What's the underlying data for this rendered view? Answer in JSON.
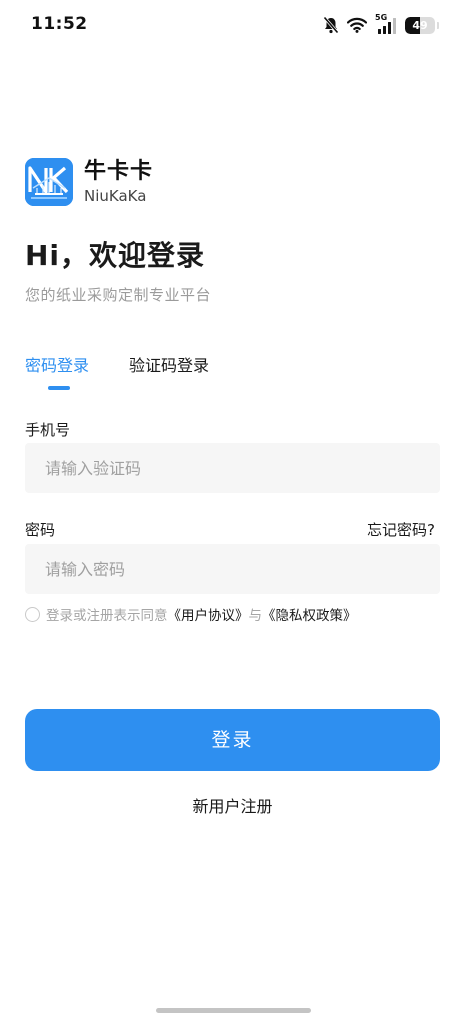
{
  "status_bar": {
    "time": "11:52",
    "network": "5G",
    "battery_level": "49",
    "battery_fraction": 0.49,
    "icons": [
      "silent-bell-icon",
      "wifi-icon",
      "signal-5g-icon",
      "battery-icon"
    ]
  },
  "brand": {
    "name": "牛卡卡",
    "subtitle": "NiuKaKa",
    "logo_icon": "niukaka-logo-icon"
  },
  "greeting": {
    "title": "Hi，欢迎登录",
    "subtitle": "您的纸业采购定制专业平台"
  },
  "tabs": [
    {
      "label": "密码登录",
      "active": true
    },
    {
      "label": "验证码登录",
      "active": false
    }
  ],
  "form": {
    "phone_label": "手机号",
    "phone_placeholder": "请输入验证码",
    "phone_value": "",
    "password_label": "密码",
    "password_placeholder": "请输入密码",
    "password_value": "",
    "forgot_label": "忘记密码?"
  },
  "agreement": {
    "checked": false,
    "prefix": "登录或注册表示同意",
    "user_agreement": "《用户协议》",
    "and": "与",
    "privacy_policy": "《隐私权政策》"
  },
  "actions": {
    "login_label": "登录",
    "register_label": "新用户注册"
  },
  "colors": {
    "accent": "#2e8ff0",
    "input_bg": "#f6f6f6",
    "hint_text": "#a5a5a5"
  }
}
